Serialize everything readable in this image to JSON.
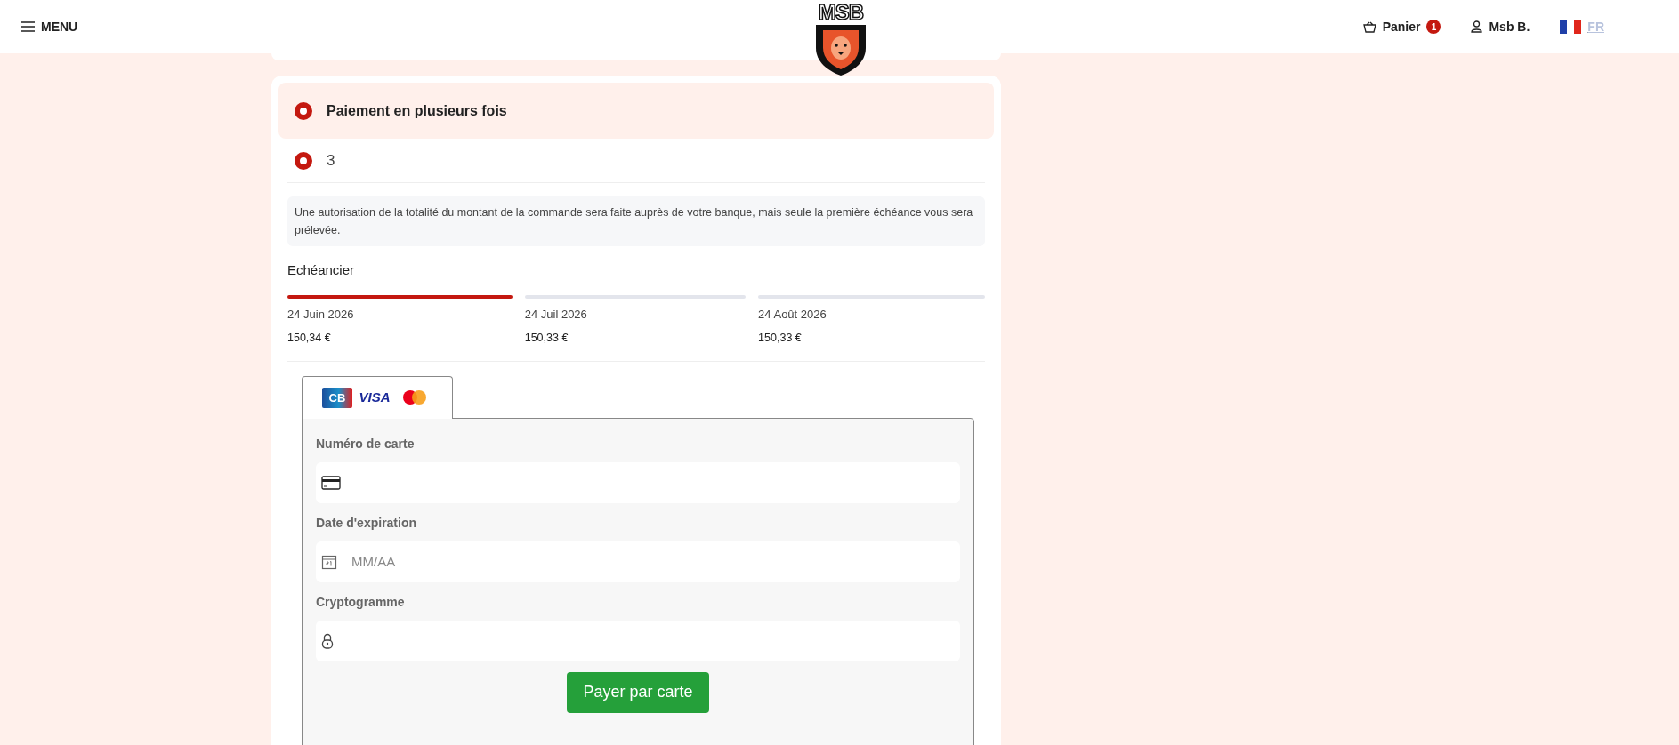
{
  "header": {
    "menu_label": "MENU",
    "logo_text": "MSB",
    "cart_label": "Panier",
    "cart_count": "1",
    "user_label": "Msb B.",
    "language": "FR"
  },
  "payment_option": {
    "label": "Paiement en plusieurs fois",
    "selected": true
  },
  "installment_options": [
    {
      "label": "3",
      "selected": true
    }
  ],
  "notice": "Une autorisation de la totalité du montant de la commande sera faite auprès de votre banque, mais seule la première échéance vous sera prélevée.",
  "schedule": {
    "title": "Echéancier",
    "items": [
      {
        "date": "24 Juin 2026",
        "amount": "150,34 €",
        "selected": true
      },
      {
        "date": "24 Juil 2026",
        "amount": "150,33 €",
        "selected": false
      },
      {
        "date": "24 Août 2026",
        "amount": "150,33 €",
        "selected": false
      }
    ]
  },
  "card_tab": {
    "brands": [
      {
        "kind": "cb",
        "text": "CB"
      },
      {
        "kind": "visa",
        "text": "VISA"
      },
      {
        "kind": "mastercard"
      }
    ]
  },
  "fields": [
    {
      "label": "Numéro de carte",
      "kind": "card"
    },
    {
      "label": "Date d'expiration",
      "kind": "date",
      "placeholder": "MM/AA"
    },
    {
      "label": "Cryptogramme",
      "kind": "lock"
    }
  ],
  "pay_button": "Payer par carte"
}
